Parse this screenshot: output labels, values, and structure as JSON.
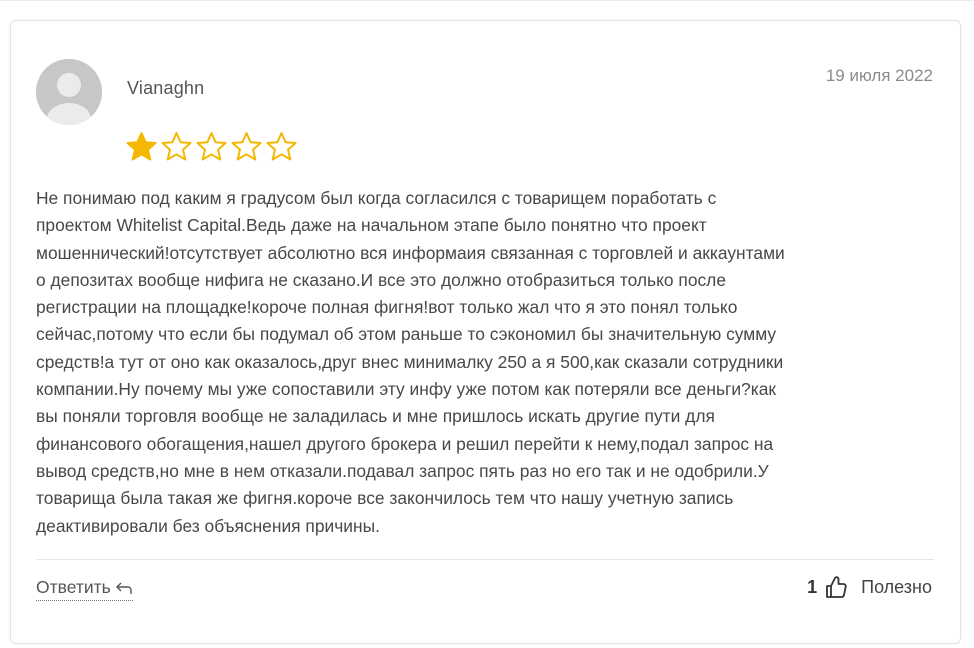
{
  "review": {
    "author": "Vianaghn",
    "date": "19 июля 2022",
    "rating": 1,
    "rating_max": 5,
    "text_lines": [
      "Не понимаю под каким я градусом был когда согласился с товарищем поработать с",
      "проектом Whitelist Capital.Ведь даже на начальном этапе было понятно что проект",
      "мошеннический!отсутствует абсолютно вся информаия связанная с торговлей и аккаунтами",
      "о депозитах вообще нифига не сказано.И все это должно отобразиться только после",
      "регистрации на площадке!короче полная фигня!вот только жал что я это понял только",
      "сейчас,потому что если бы подумал об этом раньше то сэкономил бы значительную сумму",
      "средств!а тут от оно как оказалось,друг внес минималку 250 а я 500,как сказали сотрудники",
      "компании.Ну почему мы уже сопоставили эту инфу уже потом как потеряли все деньги?как",
      "вы поняли торговля вообще не заладилась и мне пришлось искать другие пути для",
      "финансового обогащения,нашел другого брокера и решил перейти к нему,подал запрос на",
      "вывод средств,но мне в нем отказали.подавал запрос пять раз но его так и не одобрили.У",
      "товарища была такая же фигня.короче все закончилось тем что нашу учетную запись",
      "деактивировали без объяснения причины."
    ]
  },
  "actions": {
    "reply_label": "Ответить",
    "useful_count": "1",
    "useful_label": "Полезно"
  },
  "colors": {
    "star_filled": "#f5b800",
    "star_outline": "#f5b800"
  }
}
